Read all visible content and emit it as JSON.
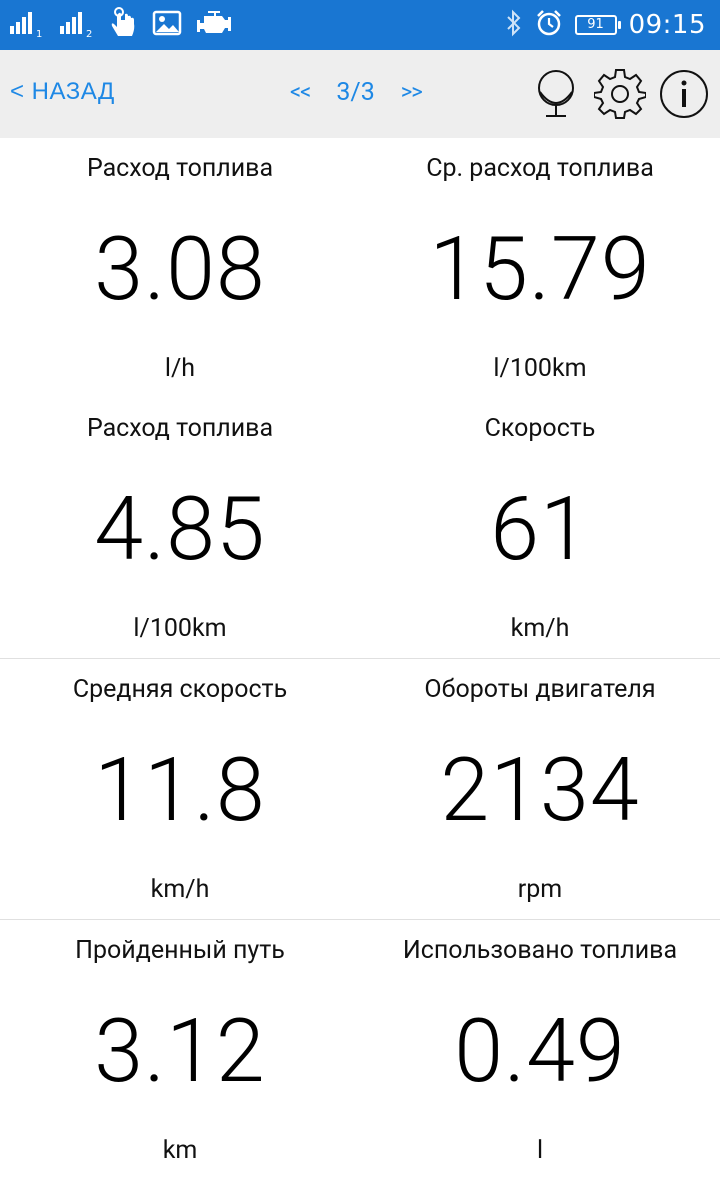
{
  "statusbar": {
    "sim1": "1",
    "sim2": "2",
    "battery": "91",
    "time": "09:15"
  },
  "toolbar": {
    "back_label": "< НАЗАД",
    "prev_label": "<<",
    "page": "3/3",
    "next_label": ">>",
    "icons": [
      "globe-icon",
      "gear-icon",
      "info-icon"
    ]
  },
  "gauges": [
    {
      "label": "Расход топлива",
      "value": "3.08",
      "unit": "l/h"
    },
    {
      "label": "Ср. расход топлива",
      "value": "15.79",
      "unit": "l/100km"
    },
    {
      "label": "Расход топлива",
      "value": "4.85",
      "unit": "l/100km"
    },
    {
      "label": "Скорость",
      "value": "61",
      "unit": "km/h"
    },
    {
      "label": "Средняя скорость",
      "value": "11.8",
      "unit": "km/h"
    },
    {
      "label": "Обороты двигателя",
      "value": "2134",
      "unit": "rpm"
    },
    {
      "label": "Пройденный путь",
      "value": "3.12",
      "unit": "km"
    },
    {
      "label": "Использовано топлива",
      "value": "0.49",
      "unit": "l"
    }
  ],
  "colors": {
    "statusbar": "#1976d2",
    "toolbar": "#eeeeee",
    "accent": "#1e88e5"
  }
}
